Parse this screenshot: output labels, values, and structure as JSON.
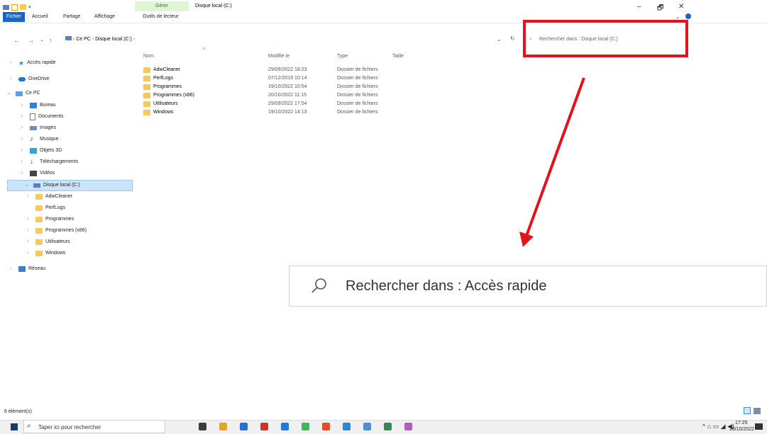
{
  "ribbon": {
    "tabs": [
      "Fichier",
      "Accueil",
      "Partage",
      "Affichage",
      "Outils de lecteur"
    ],
    "contextual_header": "Gérer",
    "window_title": "Disque local (C:)"
  },
  "window_controls": {
    "minimize": "–",
    "maximize": "🗗",
    "close": "✕"
  },
  "address": {
    "crumbs": [
      "Ce PC",
      "Disque local (C:)"
    ],
    "separator": "›"
  },
  "search": {
    "placeholder": "Rechercher dans : Disque local (C:)"
  },
  "nav_pane": {
    "quick_access": "Accès rapide",
    "onedrive": "OneDrive",
    "this_pc": "Ce PC",
    "pc_items": [
      "Bureau",
      "Documents",
      "Images",
      "Musique",
      "Objets 3D",
      "Téléchargements",
      "Vidéos"
    ],
    "drive": "Disque local (C:)",
    "drive_items": [
      "AdwCleaner",
      "PerfLogs",
      "Programmes",
      "Programmes (x86)",
      "Utilisateurs",
      "Windows"
    ],
    "network": "Réseau"
  },
  "file_list": {
    "columns": [
      "Nom",
      "Modifié le",
      "Type",
      "Taille"
    ],
    "rows": [
      {
        "name": "AdwCleaner",
        "modified": "29/09/2022 18:23",
        "type": "Dossier de fichiers"
      },
      {
        "name": "PerfLogs",
        "modified": "07/12/2019 10:14",
        "type": "Dossier de fichiers"
      },
      {
        "name": "Programmes",
        "modified": "19/10/2022 10:54",
        "type": "Dossier de fichiers"
      },
      {
        "name": "Programmes (x86)",
        "modified": "20/10/2022 11:15",
        "type": "Dossier de fichiers"
      },
      {
        "name": "Utilisateurs",
        "modified": "29/09/2022 17:54",
        "type": "Dossier de fichiers"
      },
      {
        "name": "Windows",
        "modified": "19/10/2022 14:13",
        "type": "Dossier de fichiers"
      }
    ]
  },
  "zoom_callout": {
    "text": "Rechercher dans : Accès rapide"
  },
  "status": {
    "count": "6 élément(s)"
  },
  "taskbar": {
    "search_placeholder": "Taper ici pour rechercher",
    "time": "17:25",
    "date": "20/10/2022",
    "app_colors": [
      "#3b3b3b",
      "#e8a317",
      "#2a6fd6",
      "#d93025",
      "#1e7be0",
      "#3cba54",
      "#e04f2a",
      "#2b88d8",
      "#4a90d9",
      "#2e8b57",
      "#b05fbf"
    ]
  },
  "colors": {
    "highlight_red": "#e6121b",
    "accent_blue": "#1a63c9"
  }
}
